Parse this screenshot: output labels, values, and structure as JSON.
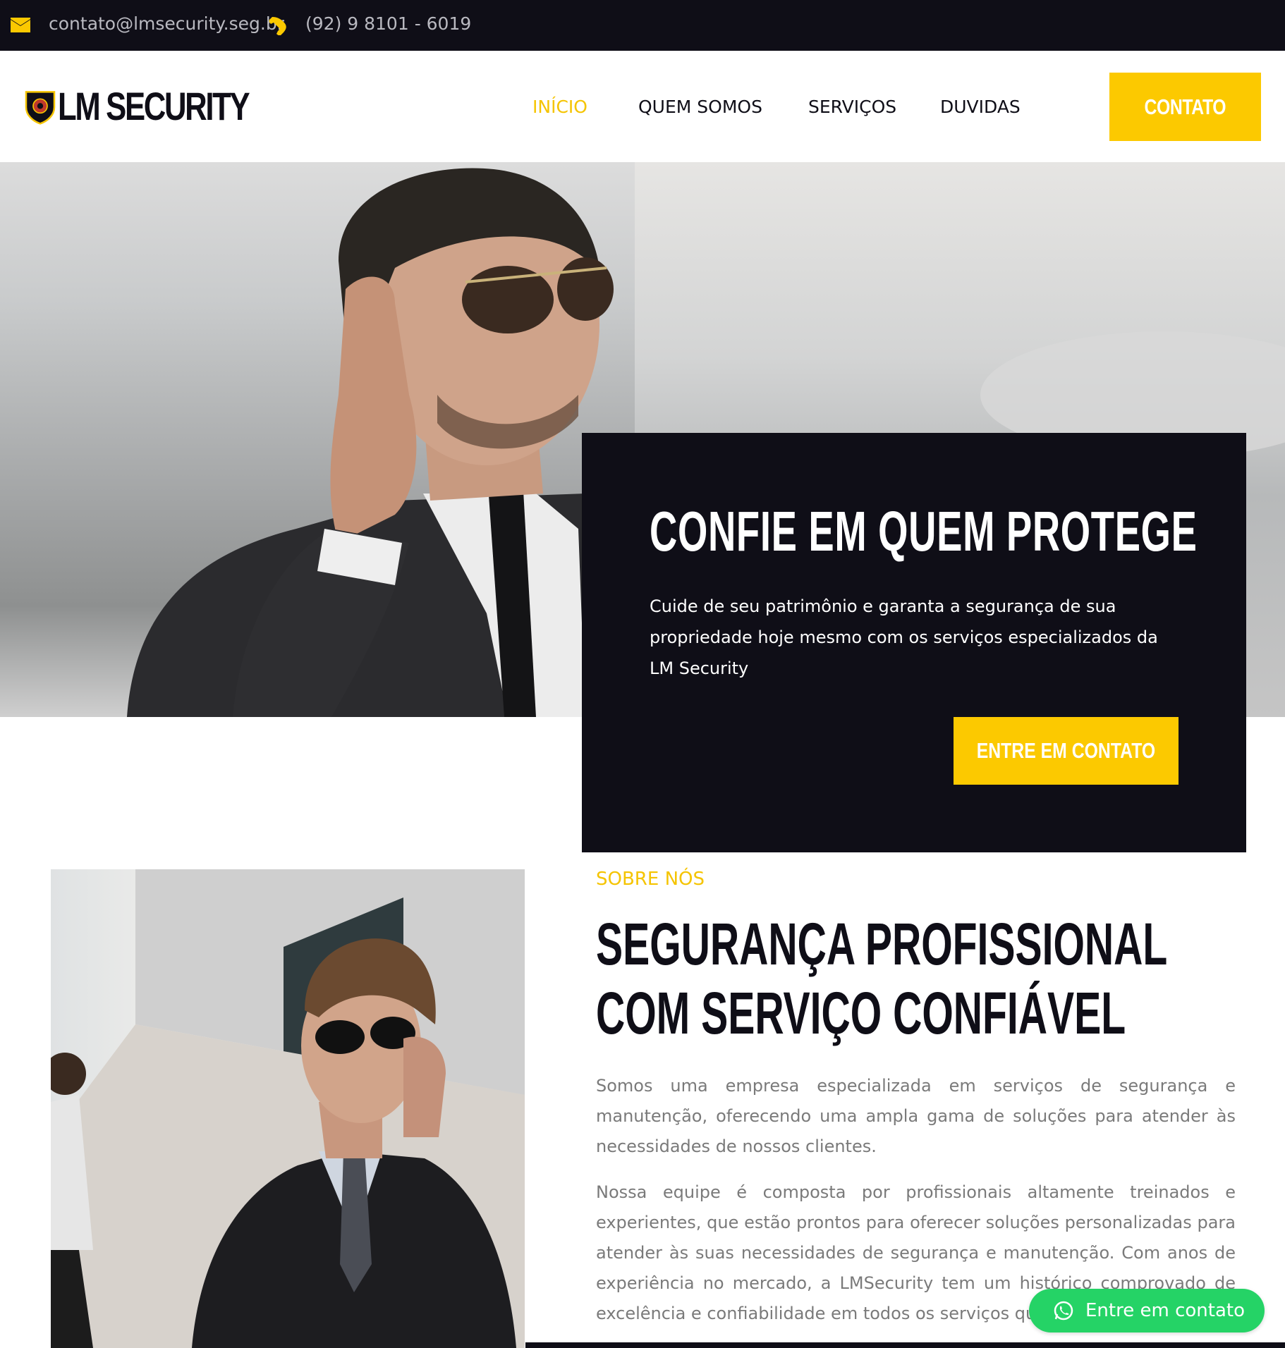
{
  "topbar": {
    "email": "contato@lmsecurity.seg.br",
    "phone": "(92) 9 8101 - 6019",
    "email_icon": "envelope-icon",
    "phone_icon": "phone-icon"
  },
  "header": {
    "logo_text": "LM SECURITY",
    "nav": [
      {
        "label": "INÍCIO",
        "active": true
      },
      {
        "label": "QUEM SOMOS",
        "active": false
      },
      {
        "label": "SERVIÇOS",
        "active": false
      },
      {
        "label": "DUVIDAS",
        "active": false
      }
    ],
    "cta_label": "CONTATO"
  },
  "hero": {
    "title": "CONFIE EM QUEM PROTEGE",
    "description": "Cuide de seu patrimônio e garanta a segurança de sua propriedade hoje mesmo com os serviços especializados da LM Security",
    "cta_label": "ENTRE EM CONTATO"
  },
  "about": {
    "kicker": "SOBRE NÓS",
    "title": "SEGURANÇA PROFISSIONAL COM SERVIÇO CONFIÁVEL",
    "paragraph1": "Somos uma empresa especializada em serviços de segurança e manutenção, oferecendo uma ampla gama de soluções para atender às necessidades de nossos clientes.",
    "paragraph2": "Nossa equipe é composta por profissionais altamente treinados e experientes, que estão prontos para oferecer soluções personalizadas para atender às suas necessidades de segurança e manutenção. Com anos de experiência no mercado, a LMSecurity tem um histórico comprovado de excelência e confiabilidade em todos os serviços que oferecemos."
  },
  "whatsapp": {
    "label": "Entre em contato",
    "icon": "whatsapp-icon"
  },
  "colors": {
    "accent": "#fcc900",
    "dark": "#0f0e17",
    "whatsapp": "#25d366",
    "body_text": "#7a7a7a"
  }
}
